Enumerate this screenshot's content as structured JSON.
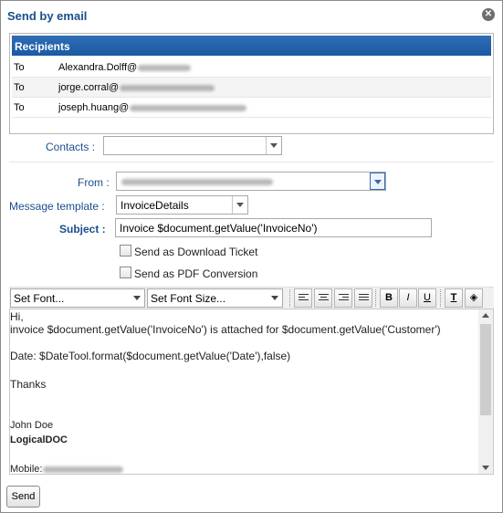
{
  "dialog": {
    "title": "Send by email"
  },
  "recipients": {
    "header": "Recipients",
    "rows": [
      {
        "type": "To",
        "email": "Alexandra.Dolff@"
      },
      {
        "type": "To",
        "email": "jorge.corral@"
      },
      {
        "type": "To",
        "email": "joseph.huang@"
      }
    ]
  },
  "contacts": {
    "label": "Contacts :",
    "value": ""
  },
  "from": {
    "label": "From :",
    "value": ""
  },
  "template": {
    "label": "Message template :",
    "value": "InvoiceDetails"
  },
  "subject": {
    "label": "Subject :",
    "value": "Invoice $document.getValue('InvoiceNo')"
  },
  "options": {
    "download_ticket": "Send as Download Ticket",
    "pdf_conversion": "Send as PDF Conversion"
  },
  "toolbar": {
    "font": "Set Font...",
    "font_size": "Set Font Size...",
    "bold": "B",
    "italic": "I",
    "underline": "U",
    "text_color": "T"
  },
  "message": {
    "lines": [
      "Hi,",
      "invoice $document.getValue('InvoiceNo') is attached for $document.getValue('Customer')",
      "Date: $DateTool.format($document.getValue('Date'),false)",
      "Thanks",
      "John Doe",
      "LogicalDOC",
      "Mobile:"
    ]
  },
  "actions": {
    "send": "Send"
  }
}
